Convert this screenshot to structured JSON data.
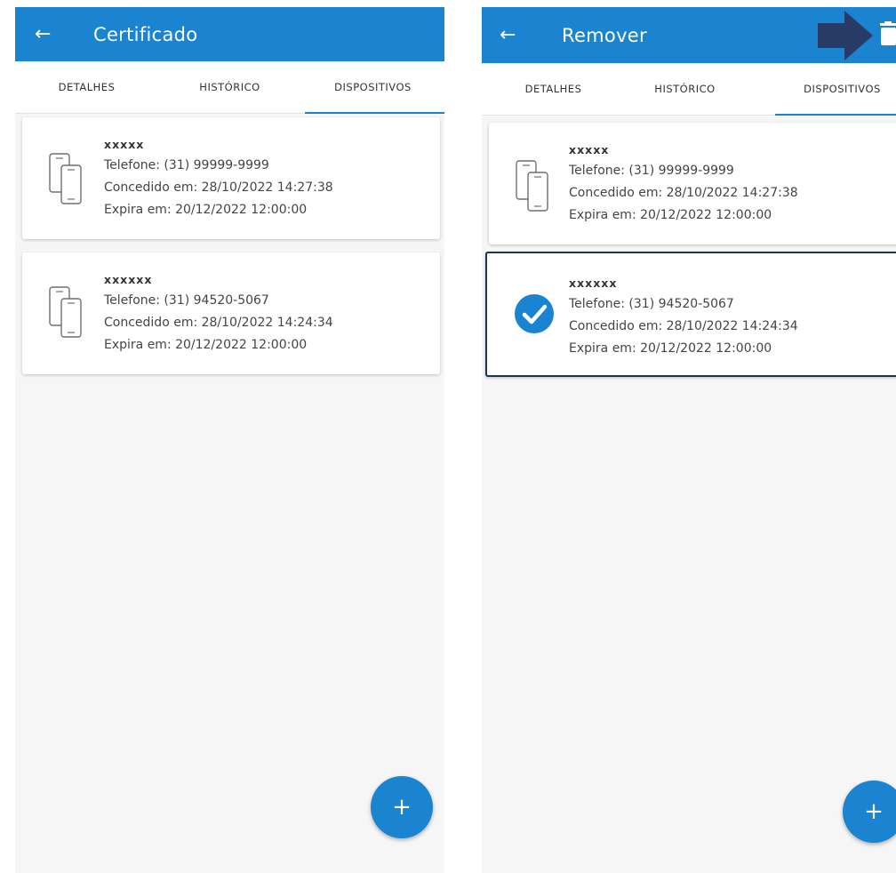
{
  "screens": [
    {
      "title": "Certificado",
      "tabs": [
        "DETALHES",
        "HISTÓRICO",
        "DISPOSITIVOS"
      ],
      "active_tab": "DISPOSITIVOS",
      "devices": [
        {
          "name": "xxxxx",
          "phone": "Telefone: (31) 99999-9999",
          "granted": "Concedido em: 28/10/2022 14:27:38",
          "expires": "Expira em: 20/12/2022 12:00:00",
          "selected": false
        },
        {
          "name": "xxxxxx",
          "phone": "Telefone: (31) 94520-5067",
          "granted": "Concedido em: 28/10/2022 14:24:34",
          "expires": "Expira em: 20/12/2022 12:00:00",
          "selected": false
        }
      ],
      "fab_label": "+"
    },
    {
      "title": "Remover",
      "tabs": [
        "DETALHES",
        "HISTÓRICO",
        "DISPOSITIVOS"
      ],
      "active_tab": "DISPOSITIVOS",
      "devices": [
        {
          "name": "xxxxx",
          "phone": "Telefone: (31) 99999-9999",
          "granted": "Concedido em: 28/10/2022 14:27:38",
          "expires": "Expira em: 20/12/2022 12:00:00",
          "selected": false
        },
        {
          "name": "xxxxxx",
          "phone": "Telefone: (31) 94520-5067",
          "granted": "Concedido em: 28/10/2022 14:24:34",
          "expires": "Expira em: 20/12/2022 12:00:00",
          "selected": true
        }
      ],
      "fab_label": "+"
    }
  ],
  "colors": {
    "primary": "#1a84d1",
    "selection_border": "#1e3350",
    "annotation_arrow": "#283a66"
  },
  "icons": {
    "back": "arrow-left-icon",
    "device": "phones-icon",
    "selected": "check-circle-icon",
    "delete": "trash-icon",
    "add": "plus-icon"
  }
}
